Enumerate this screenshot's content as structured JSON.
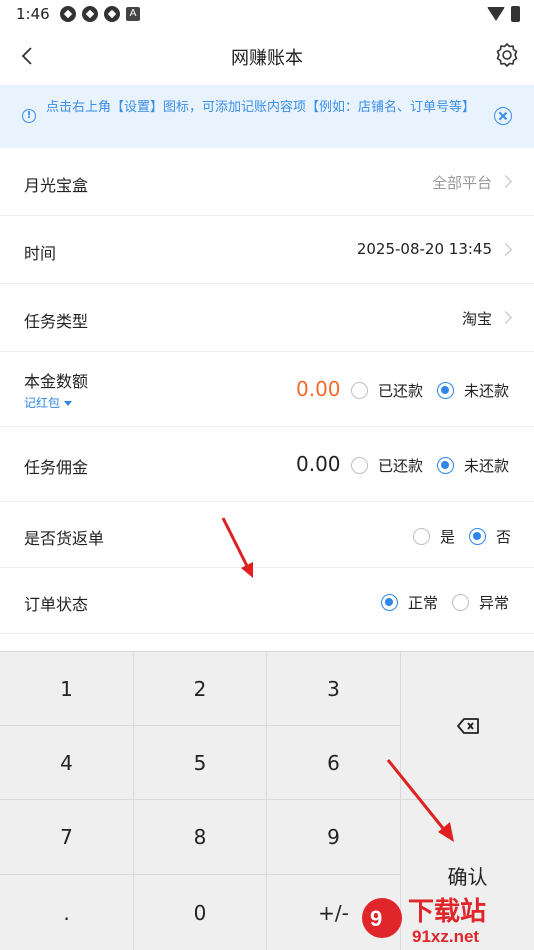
{
  "status": {
    "time": "1:46",
    "a_icon": "A"
  },
  "nav": {
    "title": "网赚账本"
  },
  "tip": {
    "text": "点击右上角【设置】图标，可添加记账内容项【例如：店铺名、订单号等】"
  },
  "rows": {
    "platform": {
      "label": "月光宝盒",
      "value": "全部平台"
    },
    "time": {
      "label": "时间",
      "value": "2025-08-20 13:45"
    },
    "task_type": {
      "label": "任务类型",
      "value": "淘宝"
    },
    "principal": {
      "label": "本金数额",
      "sub": "记红包",
      "amount": "0.00",
      "opt1": "已还款",
      "opt2": "未还款",
      "selected": "未还款"
    },
    "commission": {
      "label": "任务佣金",
      "amount": "0.00",
      "opt1": "已还款",
      "opt2": "未还款",
      "selected": "未还款"
    },
    "return_order": {
      "label": "是否货返单",
      "opt1": "是",
      "opt2": "否",
      "selected": "否"
    },
    "order_status": {
      "label": "订单状态",
      "opt1": "正常",
      "opt2": "异常",
      "selected": "正常"
    }
  },
  "keypad": {
    "keys": [
      "1",
      "2",
      "3",
      "4",
      "5",
      "6",
      "7",
      "8",
      "9",
      ".",
      "0",
      "+/-"
    ],
    "confirm": "确认"
  },
  "watermark": {
    "text1": "下载站",
    "text2": "91xz.net"
  },
  "colors": {
    "accent": "#2f86e9",
    "amount_highlight": "#f26a2b",
    "tip_bg": "#e9f3fd",
    "annotation": "#e02020"
  }
}
